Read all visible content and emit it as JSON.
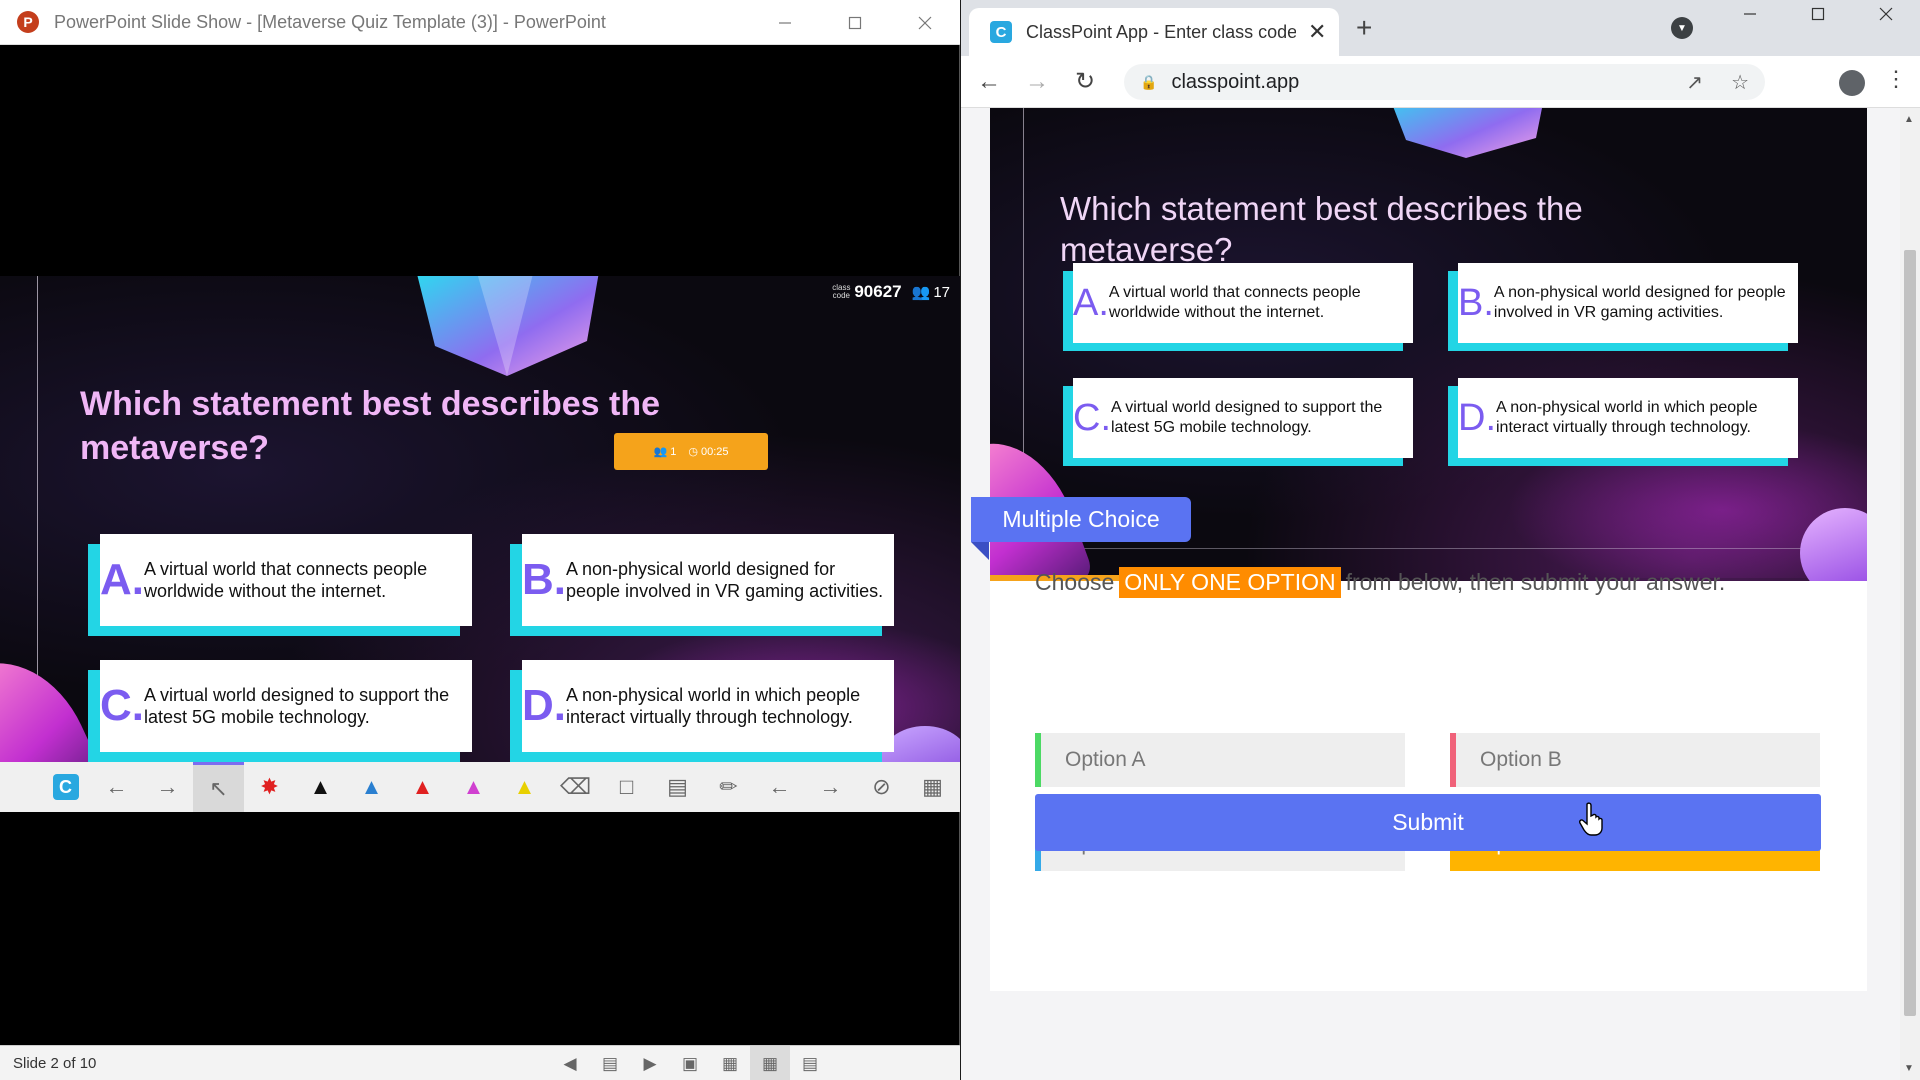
{
  "ppt": {
    "window_title": "PowerPoint Slide Show - [Metaverse Quiz Template (3)] - PowerPoint",
    "class_code_label": "class code",
    "class_code": "90627",
    "participant_count": "17",
    "question": "Which statement best describes the metaverse?",
    "responses_count": "1",
    "timer": "00:25",
    "answers": [
      {
        "letter": "A.",
        "text": "A virtual world that connects people worldwide without the internet."
      },
      {
        "letter": "B.",
        "text": "A non-physical world designed for people involved in VR gaming activities."
      },
      {
        "letter": "C.",
        "text": "A virtual world designed to support the latest 5G mobile technology."
      },
      {
        "letter": "D.",
        "text": "A non-physical world in which people interact virtually through technology."
      }
    ],
    "toolbar_icons": [
      "classpoint-icon",
      "arrow-left-icon",
      "arrow-right-icon",
      "pointer-icon",
      "laser-pen-icon",
      "pen-black-icon",
      "pen-blue-icon",
      "pen-red-icon",
      "pen-pink-icon",
      "highlighter-icon",
      "eraser-icon",
      "whiteboard-icon",
      "chart-icon",
      "draggable-icon",
      "prev-icon",
      "next-icon",
      "hide-icon",
      "more-icon"
    ],
    "status": "Slide 2 of 10"
  },
  "chrome": {
    "tab_title": "ClassPoint App - Enter class code",
    "url": "classpoint.app",
    "question": "Which statement best describes the metaverse?",
    "answers": [
      {
        "letter": "A.",
        "text": "A virtual world that connects people worldwide without the internet."
      },
      {
        "letter": "B.",
        "text": "A non-physical world designed for people involved in VR gaming activities."
      },
      {
        "letter": "C.",
        "text": "A virtual world designed to support the latest 5G mobile technology."
      },
      {
        "letter": "D.",
        "text": "A non-physical world in which people interact virtually through technology."
      }
    ],
    "activity_type": "Multiple Choice",
    "instruction_prefix": "Choose",
    "instruction_highlight": "ONLY ONE OPTION",
    "instruction_suffix": "from below, then submit your answer.",
    "options": [
      {
        "label": "Option A",
        "color": "#4cd964"
      },
      {
        "label": "Option B",
        "color": "#f0627a"
      },
      {
        "label": "Option C",
        "color": "#34a9e8"
      },
      {
        "label": "Option D",
        "color": "#ffb400"
      }
    ],
    "selected_option": "Option D",
    "submit_label": "Submit"
  },
  "colors": {
    "accent": "#5a73f2",
    "highlight": "#ff8c00",
    "selected": "#ffb400",
    "card_shadow": "#23d5e5",
    "letter": "#7b5cf0"
  }
}
